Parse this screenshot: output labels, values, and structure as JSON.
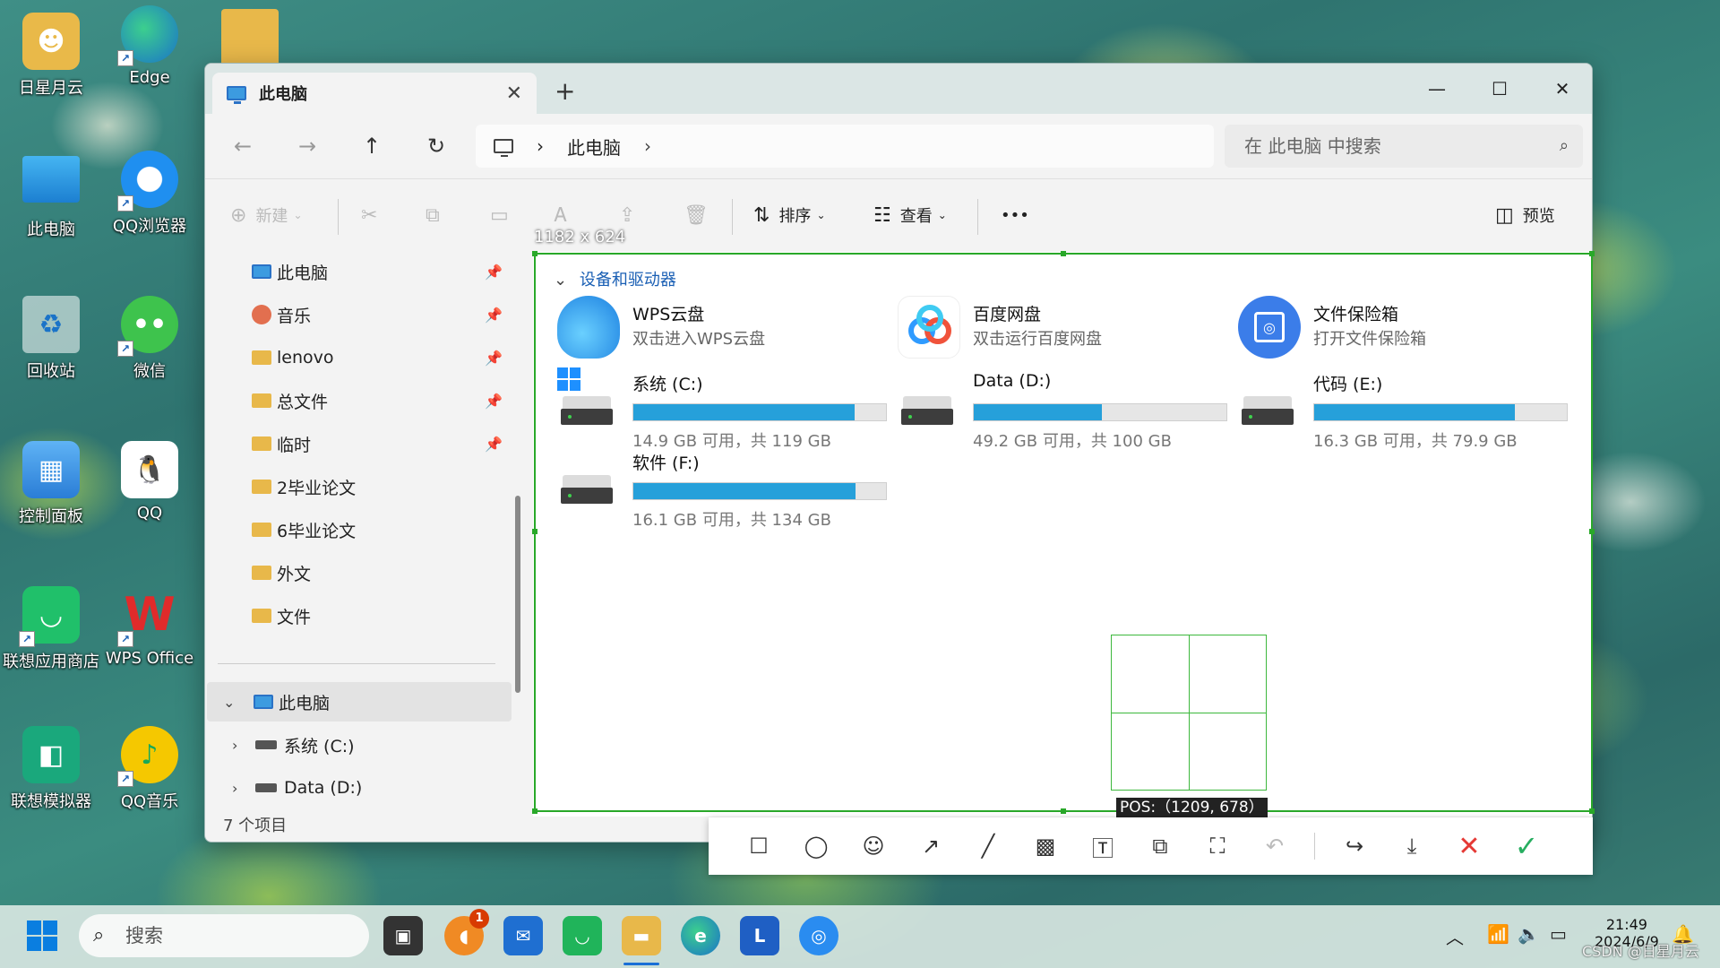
{
  "desktop": {
    "icons": [
      {
        "label": "日星月云",
        "icon": "user-folder-icon"
      },
      {
        "label": "Edge",
        "icon": "edge-icon"
      },
      {
        "label": "",
        "icon": "folder-icon"
      },
      {
        "label": "此电脑",
        "icon": "monitor-icon"
      },
      {
        "label": "QQ浏览器",
        "icon": "qq-browser-icon"
      },
      {
        "label": "回收站",
        "icon": "recycle-bin-icon"
      },
      {
        "label": "微信",
        "icon": "wechat-icon"
      },
      {
        "label": "控制面板",
        "icon": "control-panel-icon"
      },
      {
        "label": "QQ",
        "icon": "qq-icon"
      },
      {
        "label": "联想应用商店",
        "icon": "lenovo-store-icon"
      },
      {
        "label": "WPS Office",
        "icon": "wps-office-icon"
      },
      {
        "label": "联想模拟器",
        "icon": "lenovo-emulator-icon"
      },
      {
        "label": "QQ音乐",
        "icon": "qq-music-icon"
      }
    ]
  },
  "window": {
    "tab_title": "此电脑",
    "close_tab": "✕",
    "new_tab": "+",
    "controls": {
      "minimize": "—",
      "maximize": "☐",
      "close": "✕"
    },
    "nav": {
      "back": "←",
      "forward": "→",
      "up": "↑",
      "refresh": "↻"
    },
    "breadcrumb": {
      "sep1": "›",
      "item": "此电脑",
      "sep2": "›"
    },
    "search_placeholder": "在 此电脑 中搜索",
    "toolbar": {
      "new_label": "新建",
      "sort_label": "排序",
      "view_label": "查看",
      "more_label": "•••",
      "preview_label": "预览"
    },
    "sidebar": {
      "quick": [
        {
          "label": "此电脑",
          "icon": "pc"
        },
        {
          "label": "音乐",
          "icon": "music"
        },
        {
          "label": "lenovo",
          "icon": "folder"
        },
        {
          "label": "总文件",
          "icon": "folder"
        },
        {
          "label": "临时",
          "icon": "folder"
        },
        {
          "label": "2毕业论文",
          "icon": "folder"
        },
        {
          "label": "6毕业论文",
          "icon": "folder"
        },
        {
          "label": "外文",
          "icon": "folder"
        },
        {
          "label": "文件",
          "icon": "folder"
        }
      ],
      "tree_root": "此电脑",
      "tree_children": [
        "系统 (C:)",
        "Data (D:)"
      ]
    },
    "status": "7 个项目"
  },
  "content": {
    "group_title": "设备和驱动器",
    "apps": [
      {
        "name": "WPS云盘",
        "desc": "双击进入WPS云盘",
        "color": "#2f8ff0"
      },
      {
        "name": "百度网盘",
        "desc": "双击运行百度网盘",
        "color": "#ffffff"
      },
      {
        "name": "文件保险箱",
        "desc": "打开文件保险箱",
        "color": "#3b7de9"
      }
    ],
    "drives": [
      {
        "name": "系统 (C:)",
        "free": "14.9 GB 可用，共 119 GB",
        "used_fraction": 0.875
      },
      {
        "name": "Data (D:)",
        "free": "49.2 GB 可用，共 100 GB",
        "used_fraction": 0.508
      },
      {
        "name": "代码 (E:)",
        "free": "16.3 GB 可用，共 79.9 GB",
        "used_fraction": 0.796
      },
      {
        "name": "软件 (F:)",
        "free": "16.1 GB 可用，共 134 GB",
        "used_fraction": 0.88
      }
    ]
  },
  "snip": {
    "size_label": "1182 x 624",
    "pos_label": "POS:（1209, 678）",
    "tools": [
      "rectangle-icon",
      "ellipse-icon",
      "emoji-icon",
      "arrow-icon",
      "pen-icon",
      "mosaic-icon",
      "text-icon",
      "pin-icon",
      "ocr-icon",
      "undo-icon",
      "share-icon",
      "save-icon",
      "cancel-icon",
      "confirm-icon"
    ]
  },
  "taskbar": {
    "search_label": "搜索",
    "badge_count": "1",
    "time": "21:49",
    "date": "2024/6/9"
  },
  "watermark": "CSDN @日星月云"
}
